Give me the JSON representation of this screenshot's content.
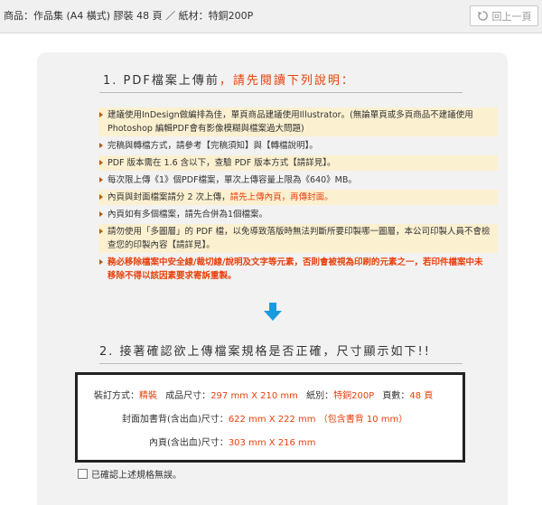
{
  "header": {
    "title": "商品：作品集 (A4 橫式) 膠裝 48 頁 ／ 紙材：特銅200P",
    "back_label": "回上一頁"
  },
  "section1": {
    "number": "1. PDF檔案上傳前",
    "highlight": "，請先閱讀下列說明："
  },
  "notes": [
    {
      "text": "建議使用InDesign做編排為佳，單頁商品建議使用Illustrator。(無論單頁或多頁商品不建議使用Photoshop 編輯PDF會有影像模糊與檔案過大問題)"
    },
    {
      "text": "完稿與轉檔方式，請參考【完稿須知】與【轉檔說明】。"
    },
    {
      "text": "PDF 版本需在 1.6 含以下，查驗 PDF 版本方式【請詳見】。"
    },
    {
      "text": "每次限上傳《1》個PDF檔案，單次上傳容量上限為《640》MB。"
    },
    {
      "text": "內頁與封面檔案請分 2 次上傳，",
      "red": "請先上傳內頁，再傳封面。"
    },
    {
      "text": "內頁如有多個檔案，請先合併為1個檔案。"
    },
    {
      "text": "請勿使用「多圖層」的 PDF 檔，以免導致落版時無法判斷所要印製哪一圖層，本公司印製人員不會檢查您的印製內容【請詳見】。"
    },
    {
      "text": "務必移除檔案中安全線/裁切線/說明及文字等元素，否則會被視為印刷的元素之一，若印件檔案中未移除不得以該因素要求寄訴重製。"
    }
  ],
  "section2": {
    "title": "2. 接著確認欲上傳檔案規格是否正確，尺寸顯示如下!!"
  },
  "specs": {
    "binding_label": "裝訂方式：",
    "binding_value": "精裝",
    "size_label": "成品尺寸：",
    "size_value": "297 mm X 210 mm",
    "paper_label": "紙別：",
    "paper_value": "特銅200P",
    "pages_label": "頁數：",
    "pages_value": "48 頁",
    "cover_label": "封面加書背(含出血)尺寸：",
    "cover_value": "622 mm X 222 mm （包含書背 10 mm）",
    "inner_label": "內頁(含出血)尺寸：",
    "inner_value": "303 mm X 216 mm"
  },
  "confirm": {
    "label": "已確認上述規格無誤。"
  },
  "colors": {
    "accent": "#e8400c",
    "arrow": "#1a9be0",
    "highlight_bg": "#fbf0d0"
  }
}
